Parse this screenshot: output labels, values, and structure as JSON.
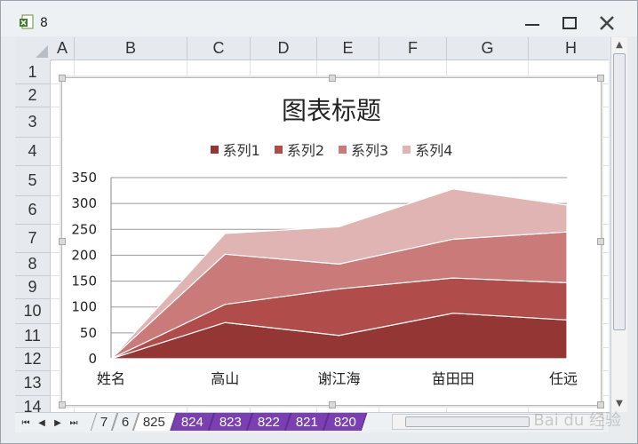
{
  "window": {
    "title": "8",
    "icon": "excel-icon"
  },
  "columns": [
    "A",
    "B",
    "C",
    "D",
    "E",
    "F",
    "G",
    "H"
  ],
  "rows": [
    "1",
    "2",
    "3",
    "4",
    "5",
    "6",
    "7",
    "8",
    "9",
    "10",
    "11",
    "12",
    "13",
    "14"
  ],
  "chart": {
    "title": "图表标题",
    "colors": [
      "#943634",
      "#b04c4a",
      "#c97a79",
      "#dfb4b3"
    ]
  },
  "chart_data": {
    "type": "area",
    "stacked": true,
    "categories": [
      "姓名",
      "高山",
      "谢江海",
      "苗田田",
      "任远"
    ],
    "series": [
      {
        "name": "系列1",
        "values": [
          0,
          70,
          45,
          88,
          75
        ]
      },
      {
        "name": "系列2",
        "values": [
          0,
          35,
          90,
          68,
          72
        ]
      },
      {
        "name": "系列3",
        "values": [
          0,
          97,
          48,
          75,
          98
        ]
      },
      {
        "name": "系列4",
        "values": [
          0,
          40,
          72,
          97,
          52
        ]
      }
    ],
    "title": "图表标题",
    "ylim": [
      0,
      350
    ],
    "yticks": [
      0,
      50,
      100,
      150,
      200,
      250,
      300,
      350
    ],
    "legend": "top",
    "grid": true
  },
  "tabs": {
    "left_labels": [
      "7",
      "6"
    ],
    "active": "825",
    "purple": [
      "824",
      "823",
      "822",
      "821",
      "820"
    ]
  },
  "watermark": "Bai du 经验"
}
